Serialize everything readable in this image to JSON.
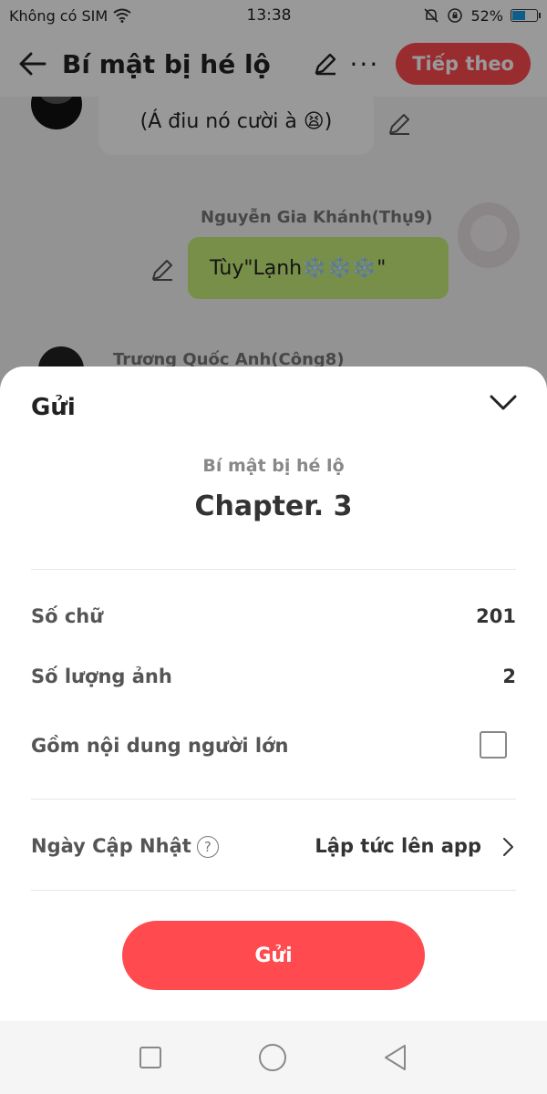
{
  "status_bar": {
    "carrier": "Không có SIM",
    "time": "13:38",
    "battery": "52%",
    "battery_level": 0.52
  },
  "header": {
    "title": "Bí mật bị hé lộ",
    "next_label": "Tiếp theo"
  },
  "chat": {
    "message1": "(Á điu nó cười à 😫)",
    "sender2": "Nguyễn Gia Khánh(Thụ9)",
    "message2": "Tùy\"Lạnh❄️❄️❄️\"",
    "sender3": "Trương Quốc Anh(Công8)"
  },
  "sheet": {
    "title": "Gửi",
    "story_title": "Bí mật bị hé lộ",
    "chapter": "Chapter. 3",
    "word_count_label": "Số chữ",
    "word_count": "201",
    "image_count_label": "Số lượng ảnh",
    "image_count": "2",
    "adult_label": "Gồm nội dung người lớn",
    "update_label": "Ngày Cập Nhật",
    "update_value": "Lập tức lên app",
    "send_label": "Gửi"
  },
  "colors": {
    "accent": "#ff4a4f",
    "green_bubble": "#c9ef7a"
  }
}
